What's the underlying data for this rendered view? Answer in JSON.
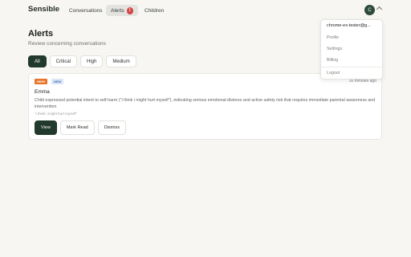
{
  "nav": {
    "brand": "Sensible",
    "conversations": "Conversations",
    "alerts": "Alerts",
    "alerts_count": "1",
    "children": "Children",
    "avatar_initial": "C"
  },
  "page": {
    "title": "Alerts",
    "subtitle": "Review concerning conversations"
  },
  "filters": [
    "All",
    "Critical",
    "High",
    "Medium"
  ],
  "alert": {
    "severity": "HIGH",
    "status": "NEW",
    "time": "30 minutes ago",
    "child": "Emma",
    "summary": "Child expressed potential intent to self-harm (\"i think i might hurt myself\"), indicating serious emotional distress and active safety risk that requires immediate parental awareness and intervention",
    "quote": "\"i think i might hurt myself\"",
    "actions": {
      "view": "View",
      "mark_read": "Mark Read",
      "dismiss": "Dismiss"
    }
  },
  "menu": {
    "email": "chrome-ex-tester@g...",
    "profile": "Profile",
    "settings": "Settings",
    "billing": "Billing",
    "logout": "Logout"
  },
  "colors": {
    "accent": "#22392d",
    "high_badge": "#e8742b",
    "alert_count": "#d64545"
  }
}
